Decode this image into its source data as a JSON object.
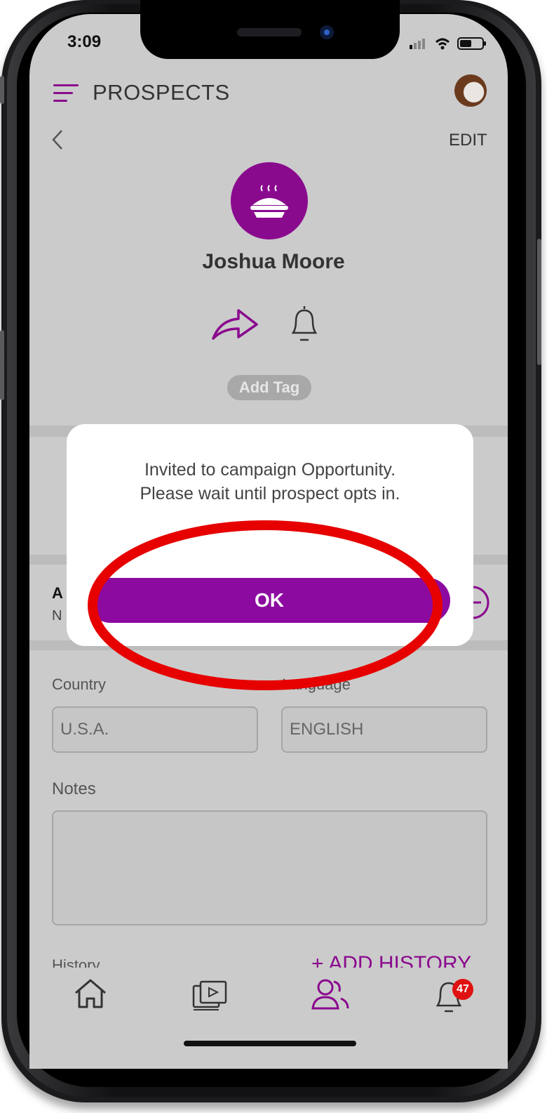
{
  "status_bar": {
    "time": "3:09"
  },
  "header": {
    "title": "PROSPECTS",
    "edit_label": "EDIT"
  },
  "profile": {
    "name": "Joshua Moore",
    "add_tag_label": "Add Tag"
  },
  "behind_modal": {
    "row_label_partial": "A",
    "row_sub_partial": "N"
  },
  "form": {
    "country_label": "Country",
    "country_value": "U.S.A.",
    "language_label": "Language",
    "language_value": "ENGLISH",
    "notes_label": "Notes",
    "history_label": "History",
    "add_history_label": "+ ADD HISTORY"
  },
  "modal": {
    "message_line1": "Invited to campaign Opportunity.",
    "message_line2": "Please wait until prospect opts in.",
    "ok_label": "OK"
  },
  "bottom_nav": {
    "items": [
      {
        "icon": "home-icon"
      },
      {
        "icon": "media-gallery-icon"
      },
      {
        "icon": "people-icon"
      },
      {
        "icon": "bell-icon"
      }
    ],
    "notification_count": "47"
  },
  "colors": {
    "accent": "#8a0a8e",
    "annotation_red": "#e60000",
    "badge": "#e01111"
  }
}
